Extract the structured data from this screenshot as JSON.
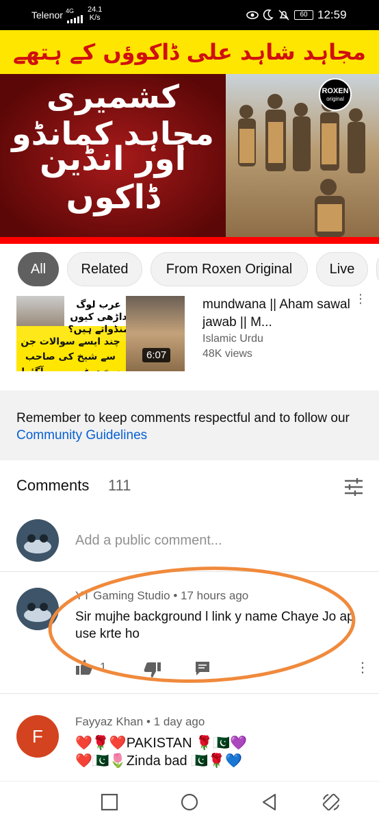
{
  "status_bar": {
    "carrier": "Telenor",
    "network": "4G",
    "speed_value": "24.1",
    "speed_unit": "K/s",
    "battery": "60",
    "time": "12:59"
  },
  "video": {
    "banner_text": "مجاہد شاہد علی ڈاکوؤں کے ہتھے کیسے چڑھا؟",
    "title_line1": "کشمیری مجاہد کمانڈو",
    "title_line2": "اور انڈین ڈاکوں",
    "logo_top": "ROXEN",
    "logo_bottom": "original"
  },
  "chips": [
    {
      "label": "All",
      "active": true
    },
    {
      "label": "Related",
      "active": false
    },
    {
      "label": "From Roxen Original",
      "active": false
    },
    {
      "label": "Live",
      "active": false
    }
  ],
  "related_video": {
    "thumb_text_top": "عرب لوگ داڑھی کیوں منڈواتے ہیں؟",
    "thumb_text_bottom": "چند ایسے سوالات جن سے شیخ کی صاحب سخت غصے میں آگئے!",
    "duration": "6:07",
    "title": "mundwana || Aham sawal jawab || M...",
    "channel": "Islamic Urdu",
    "views": "48K views"
  },
  "guidelines": {
    "text": "Remember to keep comments respectful and to follow our ",
    "link": "Community Guidelines"
  },
  "comments_header": {
    "title": "Comments",
    "count": "111"
  },
  "add_comment": {
    "placeholder": "Add a public comment..."
  },
  "comments": [
    {
      "author": "YT Gaming Studio",
      "time": "17 hours ago",
      "text": "Sir mujhe background l link y name Chaye Jo ap use krte ho",
      "likes": "1"
    },
    {
      "author": "Fayyaz Khan",
      "time": "1 day ago",
      "avatar_letter": "F",
      "line1": "❤️🌹❤️PAKISTAN 🌹🇵🇰💜",
      "line2": "❤️🇵🇰🌷Zinda bad 🇵🇰🌹💙"
    }
  ],
  "colors": {
    "accent_link": "#065fd4",
    "annotation_circle": "#f08a3c",
    "chip_active": "#606060",
    "brand_red": "#ff0000"
  }
}
